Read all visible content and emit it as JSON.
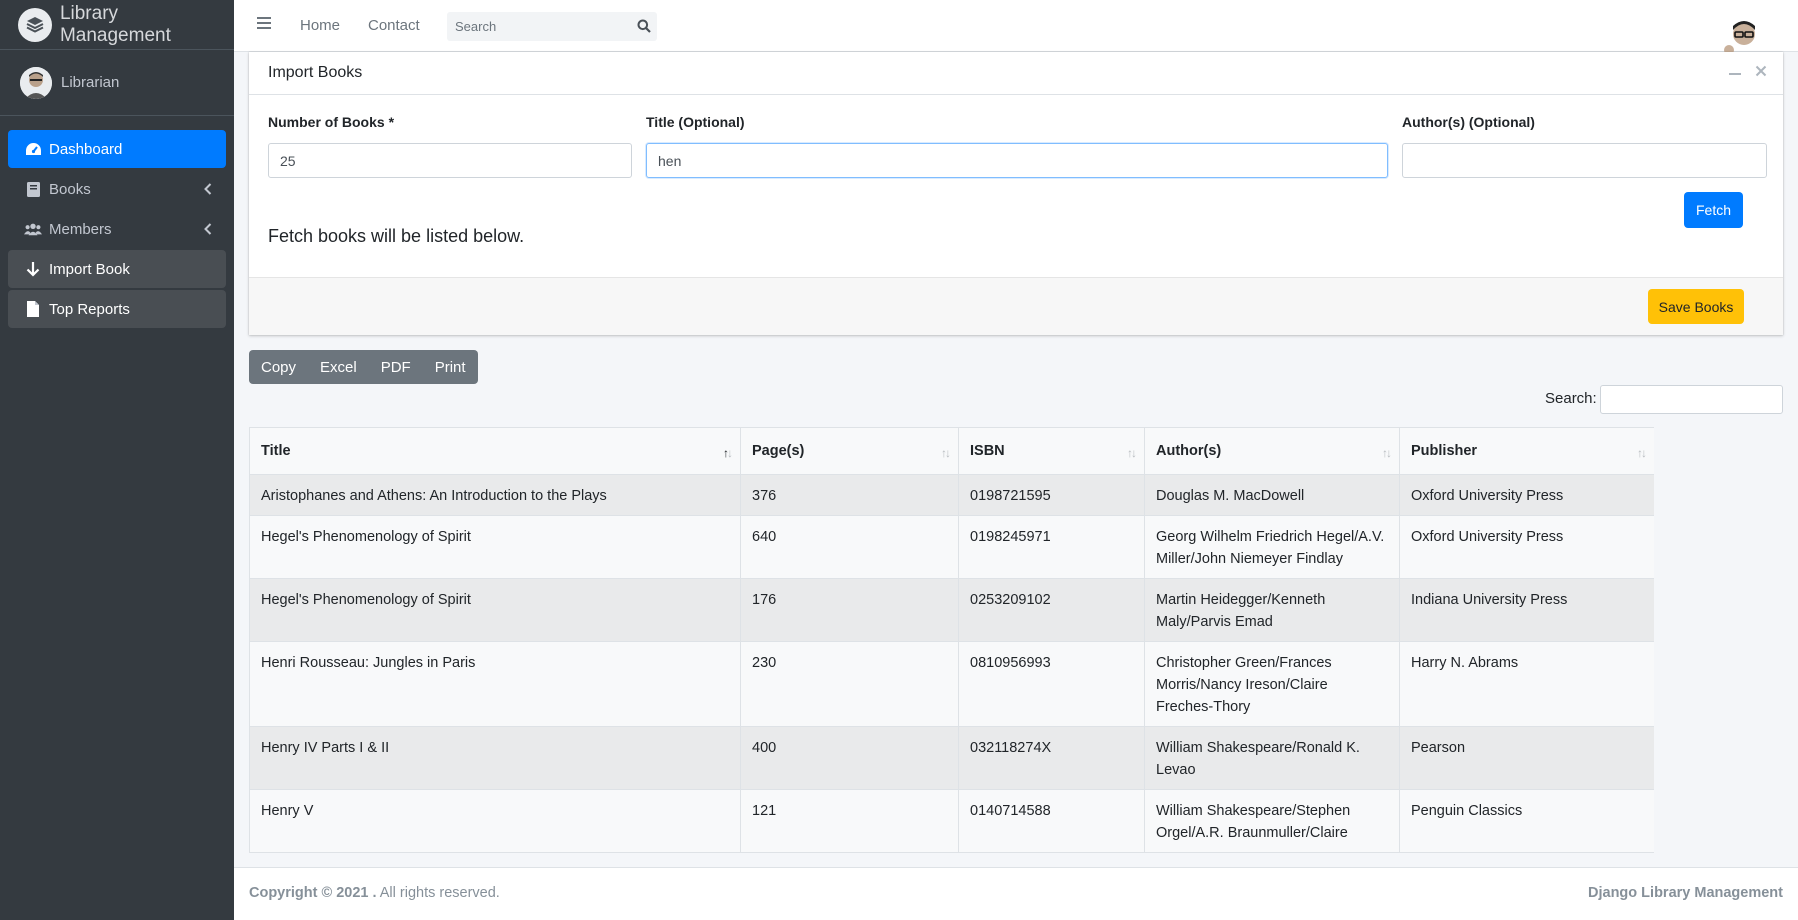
{
  "app": {
    "title": "Library Management",
    "user_name": "Librarian"
  },
  "sidebar": {
    "items": [
      {
        "label": "Dashboard",
        "icon": "tachometer-icon",
        "state": "active"
      },
      {
        "label": "Books",
        "icon": "book-icon",
        "state": "collapsed"
      },
      {
        "label": "Members",
        "icon": "users-icon",
        "state": "collapsed"
      },
      {
        "label": "Import Book",
        "icon": "arrow-down-icon",
        "state": "selected"
      },
      {
        "label": "Top Reports",
        "icon": "file-icon",
        "state": "selected"
      }
    ]
  },
  "topbar": {
    "nav": [
      "Home",
      "Contact"
    ],
    "search_placeholder": "Search"
  },
  "import_card": {
    "title": "Import Books",
    "fields": {
      "num_books": {
        "label": "Number of Books *",
        "value": "25"
      },
      "title": {
        "label": "Title (Optional)",
        "value": "hen"
      },
      "authors": {
        "label": "Author(s) (Optional)",
        "value": ""
      }
    },
    "fetch_label": "Fetch",
    "note": "Fetch books will be listed below.",
    "save_label": "Save Books"
  },
  "export_buttons": [
    "Copy",
    "Excel",
    "PDF",
    "Print"
  ],
  "table_search_label": "Search:",
  "table": {
    "columns": [
      "Title",
      "Page(s)",
      "ISBN",
      "Author(s)",
      "Publisher"
    ],
    "sorted_column": "Title",
    "rows": [
      [
        "Aristophanes and Athens: An Introduction to the Plays",
        "376",
        "0198721595",
        "Douglas M. MacDowell",
        "Oxford University Press"
      ],
      [
        "Hegel's Phenomenology of Spirit",
        "640",
        "0198245971",
        "Georg Wilhelm Friedrich Hegel/A.V. Miller/John Niemeyer Findlay",
        "Oxford University Press"
      ],
      [
        "Hegel's Phenomenology of Spirit",
        "176",
        "0253209102",
        "Martin Heidegger/Kenneth Maly/Parvis Emad",
        "Indiana University Press"
      ],
      [
        "Henri Rousseau: Jungles in Paris",
        "230",
        "0810956993",
        "Christopher Green/Frances Morris/Nancy Ireson/Claire Freches-Thory",
        "Harry N. Abrams"
      ],
      [
        "Henry IV Parts I & II",
        "400",
        "032118274X",
        "William Shakespeare/Ronald K. Levao",
        "Pearson"
      ],
      [
        "Henry V",
        "121",
        "0140714588",
        "William Shakespeare/Stephen Orgel/A.R. Braunmuller/Claire",
        "Penguin Classics"
      ]
    ]
  },
  "footer": {
    "copyright": "Copyright © 2021 .",
    "rights": " All rights reserved.",
    "brand": "Django Library Management"
  },
  "colors": {
    "sidebar_bg": "#343a40",
    "active": "#007bff",
    "warning": "#ffc107",
    "secondary": "#6c757d"
  }
}
